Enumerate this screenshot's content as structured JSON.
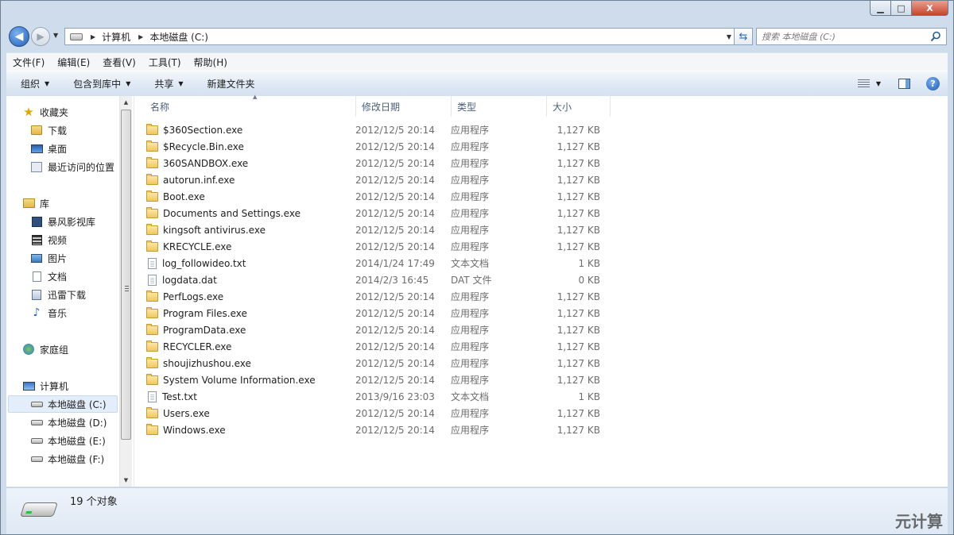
{
  "window": {
    "min_label": "▁",
    "max_label": "□",
    "close_label": "X"
  },
  "address": {
    "crumbs": [
      "计算机",
      "本地磁盘 (C:)"
    ],
    "search_placeholder": "搜索 本地磁盘 (C:)"
  },
  "menu": [
    "文件(F)",
    "编辑(E)",
    "查看(V)",
    "工具(T)",
    "帮助(H)"
  ],
  "commands": [
    "组织",
    "包含到库中",
    "共享",
    "新建文件夹"
  ],
  "help_label": "?",
  "nav": {
    "favorites": "收藏夹",
    "fav_items": [
      "下载",
      "桌面",
      "最近访问的位置"
    ],
    "libraries": "库",
    "lib_items": [
      "暴风影视库",
      "视频",
      "图片",
      "文档",
      "迅雷下载",
      "音乐"
    ],
    "homegroup": "家庭组",
    "computer": "计算机",
    "drives": [
      "本地磁盘 (C:)",
      "本地磁盘 (D:)",
      "本地磁盘 (E:)",
      "本地磁盘 (F:)"
    ]
  },
  "columns": [
    "名称",
    "修改日期",
    "类型",
    "大小"
  ],
  "files": [
    {
      "name": "$360Section.exe",
      "date": "2012/12/5 20:14",
      "type": "应用程序",
      "size": "1,127 KB",
      "icon": "folder"
    },
    {
      "name": "$Recycle.Bin.exe",
      "date": "2012/12/5 20:14",
      "type": "应用程序",
      "size": "1,127 KB",
      "icon": "folder"
    },
    {
      "name": "360SANDBOX.exe",
      "date": "2012/12/5 20:14",
      "type": "应用程序",
      "size": "1,127 KB",
      "icon": "folder"
    },
    {
      "name": "autorun.inf.exe",
      "date": "2012/12/5 20:14",
      "type": "应用程序",
      "size": "1,127 KB",
      "icon": "folder"
    },
    {
      "name": "Boot.exe",
      "date": "2012/12/5 20:14",
      "type": "应用程序",
      "size": "1,127 KB",
      "icon": "folder"
    },
    {
      "name": "Documents and Settings.exe",
      "date": "2012/12/5 20:14",
      "type": "应用程序",
      "size": "1,127 KB",
      "icon": "folder"
    },
    {
      "name": "kingsoft antivirus.exe",
      "date": "2012/12/5 20:14",
      "type": "应用程序",
      "size": "1,127 KB",
      "icon": "folder"
    },
    {
      "name": "KRECYCLE.exe",
      "date": "2012/12/5 20:14",
      "type": "应用程序",
      "size": "1,127 KB",
      "icon": "folder"
    },
    {
      "name": "log_followideo.txt",
      "date": "2014/1/24 17:49",
      "type": "文本文档",
      "size": "1 KB",
      "icon": "file"
    },
    {
      "name": "logdata.dat",
      "date": "2014/2/3 16:45",
      "type": "DAT 文件",
      "size": "0 KB",
      "icon": "file"
    },
    {
      "name": "PerfLogs.exe",
      "date": "2012/12/5 20:14",
      "type": "应用程序",
      "size": "1,127 KB",
      "icon": "folder"
    },
    {
      "name": "Program Files.exe",
      "date": "2012/12/5 20:14",
      "type": "应用程序",
      "size": "1,127 KB",
      "icon": "folder"
    },
    {
      "name": "ProgramData.exe",
      "date": "2012/12/5 20:14",
      "type": "应用程序",
      "size": "1,127 KB",
      "icon": "folder"
    },
    {
      "name": "RECYCLER.exe",
      "date": "2012/12/5 20:14",
      "type": "应用程序",
      "size": "1,127 KB",
      "icon": "folder"
    },
    {
      "name": "shoujizhushou.exe",
      "date": "2012/12/5 20:14",
      "type": "应用程序",
      "size": "1,127 KB",
      "icon": "folder"
    },
    {
      "name": "System Volume Information.exe",
      "date": "2012/12/5 20:14",
      "type": "应用程序",
      "size": "1,127 KB",
      "icon": "folder"
    },
    {
      "name": "Test.txt",
      "date": "2013/9/16 23:03",
      "type": "文本文档",
      "size": "1 KB",
      "icon": "file"
    },
    {
      "name": "Users.exe",
      "date": "2012/12/5 20:14",
      "type": "应用程序",
      "size": "1,127 KB",
      "icon": "folder"
    },
    {
      "name": "Windows.exe",
      "date": "2012/12/5 20:14",
      "type": "应用程序",
      "size": "1,127 KB",
      "icon": "folder"
    }
  ],
  "status": {
    "count_text": "19 个对象"
  },
  "watermark": "元计算"
}
